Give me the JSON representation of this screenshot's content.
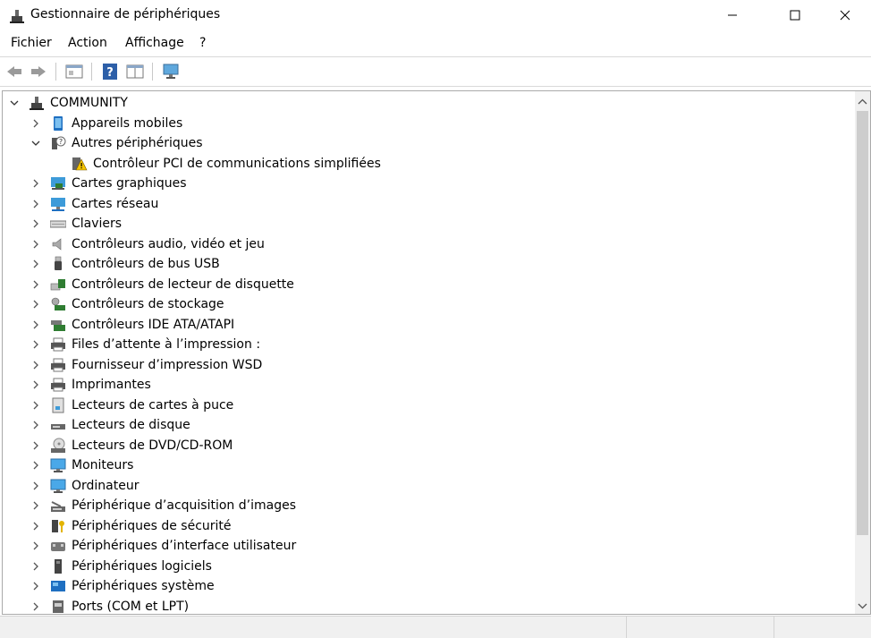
{
  "window": {
    "title": "Gestionnaire de périphériques"
  },
  "menu": {
    "items": [
      "Fichier",
      "Action",
      "Affichage",
      "?"
    ]
  },
  "toolbar": {
    "buttons": [
      "back-icon",
      "forward-icon",
      "properties-icon",
      "help-icon",
      "view-icon",
      "monitor-scan-icon"
    ]
  },
  "tree": {
    "root": "COMMUNITY",
    "items": [
      {
        "label": "Appareils mobiles",
        "icon": "mobile-device-icon"
      },
      {
        "label": "Autres périphériques",
        "icon": "unknown-device-icon",
        "expanded": true
      },
      {
        "label": "Contrôleur PCI de communications simplifiées",
        "icon": "warning-device-icon"
      },
      {
        "label": "Cartes graphiques",
        "icon": "display-adapter-icon"
      },
      {
        "label": "Cartes réseau",
        "icon": "network-adapter-icon"
      },
      {
        "label": "Claviers",
        "icon": "keyboard-icon"
      },
      {
        "label": "Contrôleurs audio, vidéo et jeu",
        "icon": "speaker-icon"
      },
      {
        "label": "Contrôleurs de bus USB",
        "icon": "usb-icon"
      },
      {
        "label": "Contrôleurs de lecteur de disquette",
        "icon": "floppy-controller-icon"
      },
      {
        "label": "Contrôleurs de stockage",
        "icon": "storage-controller-icon"
      },
      {
        "label": "Contrôleurs IDE ATA/ATAPI",
        "icon": "ide-controller-icon"
      },
      {
        "label": "Files d’attente à l’impression :",
        "icon": "print-queue-icon"
      },
      {
        "label": "Fournisseur d’impression WSD",
        "icon": "wsd-printer-icon"
      },
      {
        "label": "Imprimantes",
        "icon": "printer-icon"
      },
      {
        "label": "Lecteurs de cartes à puce",
        "icon": "smart-card-icon"
      },
      {
        "label": "Lecteurs de disque",
        "icon": "disk-drive-icon"
      },
      {
        "label": "Lecteurs de DVD/CD-ROM",
        "icon": "dvd-icon"
      },
      {
        "label": "Moniteurs",
        "icon": "monitor-icon"
      },
      {
        "label": "Ordinateur",
        "icon": "computer-icon"
      },
      {
        "label": "Périphérique d’acquisition d’images",
        "icon": "scanner-icon"
      },
      {
        "label": "Périphériques de sécurité",
        "icon": "security-device-icon"
      },
      {
        "label": "Périphériques d’interface utilisateur",
        "icon": "hid-icon"
      },
      {
        "label": "Périphériques logiciels",
        "icon": "software-device-icon"
      },
      {
        "label": "Périphériques système",
        "icon": "system-device-icon"
      },
      {
        "label": "Ports (COM et LPT)",
        "icon": "port-icon"
      }
    ]
  }
}
